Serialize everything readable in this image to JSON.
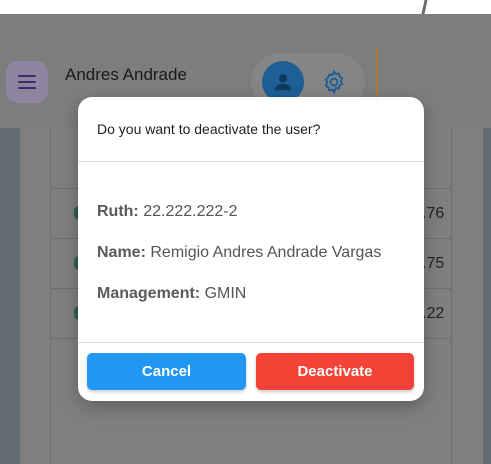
{
  "header": {
    "user_name": "Andres Andrade"
  },
  "background_table": {
    "cells": [
      ".76",
      ".75",
      ".22"
    ]
  },
  "dialog": {
    "title": "Do you want to deactivate the user?",
    "fields": [
      {
        "label": "Ruth:",
        "value": "22.222.222-2"
      },
      {
        "label": "Name:",
        "value": "Remigio Andres Andrade Vargas"
      },
      {
        "label": "Management:",
        "value": "GMIN"
      }
    ],
    "cancel_label": "Cancel",
    "deactivate_label": "Deactivate"
  },
  "colors": {
    "cancel": "#2196f3",
    "deactivate": "#f44336",
    "avatar": "#1d5f96"
  },
  "icons": [
    "menu-icon",
    "user-icon",
    "gear-icon"
  ]
}
